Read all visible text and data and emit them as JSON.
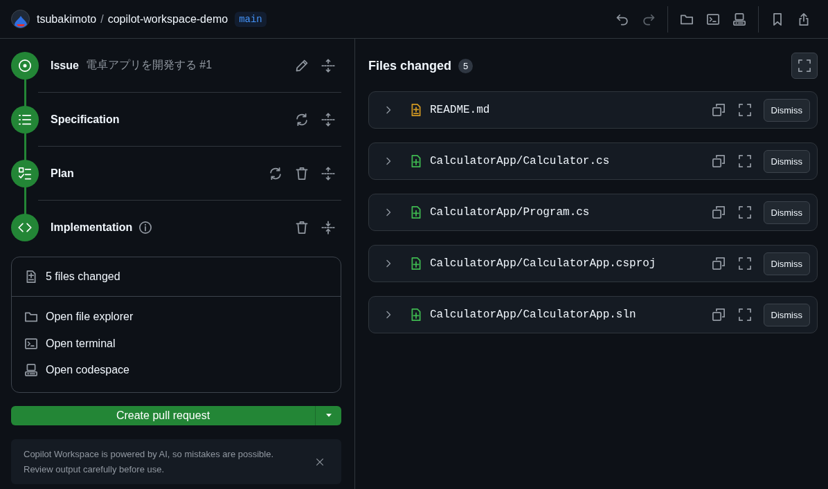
{
  "header": {
    "owner": "tsubakimoto",
    "separator": "/",
    "repo": "copilot-workspace-demo",
    "branch": "main",
    "tool_groups": [
      [
        {
          "kind": "undo",
          "disabled": false
        },
        {
          "kind": "redo",
          "disabled": true
        }
      ],
      [
        {
          "kind": "folder",
          "disabled": false
        },
        {
          "kind": "terminal",
          "disabled": false
        },
        {
          "kind": "codespace",
          "disabled": false
        }
      ],
      [
        {
          "kind": "bookmark",
          "disabled": false
        },
        {
          "kind": "share",
          "disabled": false
        }
      ]
    ]
  },
  "steps": [
    {
      "kind": "issue",
      "title": "Issue",
      "subtitle": "電卓アプリを開発する #1",
      "info": false,
      "actions": [
        {
          "kind": "edit"
        },
        {
          "kind": "unfold"
        }
      ]
    },
    {
      "kind": "list",
      "title": "Specification",
      "info": false,
      "actions": [
        {
          "kind": "sync"
        },
        {
          "kind": "unfold"
        }
      ]
    },
    {
      "kind": "tasklist",
      "title": "Plan",
      "info": false,
      "actions": [
        {
          "kind": "sync"
        },
        {
          "kind": "delete"
        },
        {
          "kind": "unfold"
        }
      ]
    },
    {
      "kind": "code",
      "title": "Implementation",
      "info": true,
      "actions": [
        {
          "kind": "delete"
        },
        {
          "kind": "fold"
        }
      ]
    }
  ],
  "summary": {
    "text": "5 files changed",
    "actions": [
      {
        "kind": "folder",
        "label": "Open file explorer"
      },
      {
        "kind": "terminal",
        "label": "Open terminal"
      },
      {
        "kind": "codespace",
        "label": "Open codespace"
      }
    ]
  },
  "create_button": {
    "label": "Create pull request"
  },
  "notice": {
    "lines": [
      "Copilot Workspace is powered by AI, so mistakes are possible.",
      "Review output carefully before use."
    ]
  },
  "files_panel": {
    "title": "Files changed",
    "count": "5",
    "files": [
      {
        "kind": "modified",
        "path": "README.md",
        "dismiss": "Dismiss"
      },
      {
        "kind": "added",
        "path": "CalculatorApp/Calculator.cs",
        "dismiss": "Dismiss"
      },
      {
        "kind": "added",
        "path": "CalculatorApp/Program.cs",
        "dismiss": "Dismiss"
      },
      {
        "kind": "added",
        "path": "CalculatorApp/CalculatorApp.csproj",
        "dismiss": "Dismiss"
      },
      {
        "kind": "added",
        "path": "CalculatorApp/CalculatorApp.sln",
        "dismiss": "Dismiss"
      }
    ]
  }
}
